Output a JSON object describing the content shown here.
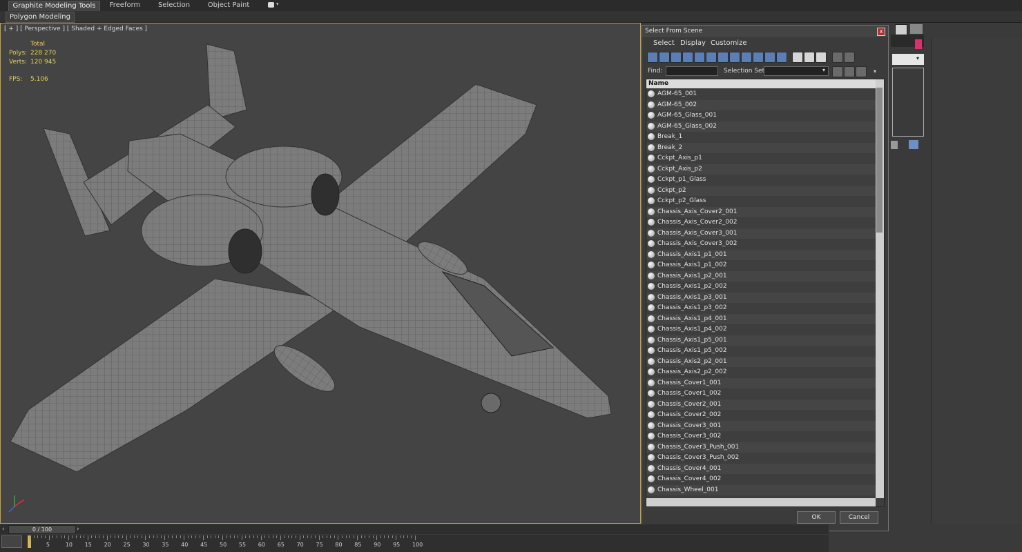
{
  "ribbon": {
    "tabs": [
      "Graphite Modeling Tools",
      "Freeform",
      "Selection",
      "Object Paint"
    ],
    "subtab": "Polygon Modeling"
  },
  "viewport": {
    "label": "[ + ] [ Perspective ] [ Shaded + Edged Faces ]",
    "stats": {
      "total_label": "Total",
      "polys_label": "Polys:",
      "polys": "228 270",
      "verts_label": "Verts:",
      "verts": "120 945",
      "fps_label": "FPS:",
      "fps": "5.106"
    }
  },
  "dialog": {
    "title": "Select From Scene",
    "close_glyph": "x",
    "menu": [
      "Select",
      "Display",
      "Customize"
    ],
    "find_label": "Find:",
    "selection_set_label": "Selection Set:",
    "column_header": "Name",
    "items": [
      "AGM-65_001",
      "AGM-65_002",
      "AGM-65_Glass_001",
      "AGM-65_Glass_002",
      "Break_1",
      "Break_2",
      "Cckpt_Axis_p1",
      "Cckpt_Axis_p2",
      "Cckpt_p1_Glass",
      "Cckpt_p2",
      "Cckpt_p2_Glass",
      "Chassis_Axis_Cover2_001",
      "Chassis_Axis_Cover2_002",
      "Chassis_Axis_Cover3_001",
      "Chassis_Axis_Cover3_002",
      "Chassis_Axis1_p1_001",
      "Chassis_Axis1_p1_002",
      "Chassis_Axis1_p2_001",
      "Chassis_Axis1_p2_002",
      "Chassis_Axis1_p3_001",
      "Chassis_Axis1_p3_002",
      "Chassis_Axis1_p4_001",
      "Chassis_Axis1_p4_002",
      "Chassis_Axis1_p5_001",
      "Chassis_Axis1_p5_002",
      "Chassis_Axis2_p2_001",
      "Chassis_Axis2_p2_002",
      "Chassis_Cover1_001",
      "Chassis_Cover1_002",
      "Chassis_Cover2_001",
      "Chassis_Cover2_002",
      "Chassis_Cover3_001",
      "Chassis_Cover3_002",
      "Chassis_Cover3_Push_001",
      "Chassis_Cover3_Push_002",
      "Chassis_Cover4_001",
      "Chassis_Cover4_002",
      "Chassis_Wheel_001"
    ],
    "ok_label": "OK",
    "cancel_label": "Cancel"
  },
  "timeline": {
    "frame_display": "0 / 100",
    "ticks": [
      "5",
      "10",
      "15",
      "20",
      "25",
      "30",
      "35",
      "40",
      "45",
      "50",
      "55",
      "60",
      "65",
      "70",
      "75",
      "80",
      "85",
      "90",
      "95",
      "100"
    ]
  },
  "colors": {
    "viewport_border": "#c9a33b",
    "stat_text": "#e8d05a",
    "accent_swatch": "#d6336c",
    "toolbar_icon": "#5b7fb3"
  }
}
